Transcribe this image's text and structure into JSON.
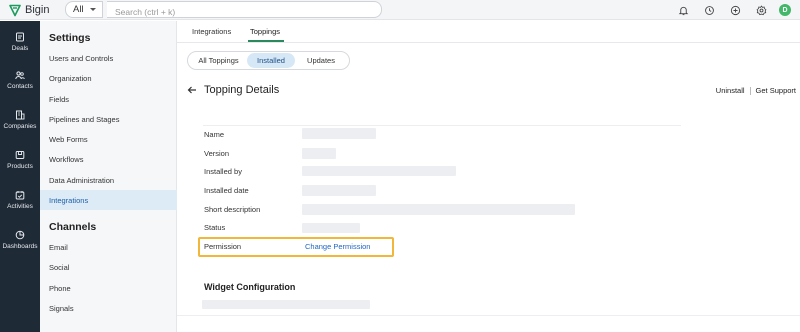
{
  "brand": {
    "name": "Bigin"
  },
  "search": {
    "module": "All",
    "placeholder": "Search (ctrl + k)"
  },
  "topbar_icons": [
    "bell-icon",
    "sync-icon",
    "plus-circle-icon",
    "gear-icon"
  ],
  "user": {
    "initial": "D",
    "color": "#43b86a"
  },
  "rail": {
    "items": [
      {
        "label": "Deals",
        "icon": "deals-icon"
      },
      {
        "label": "Contacts",
        "icon": "contacts-icon"
      },
      {
        "label": "Companies",
        "icon": "companies-icon"
      },
      {
        "label": "Products",
        "icon": "products-icon"
      },
      {
        "label": "Activities",
        "icon": "activities-icon"
      },
      {
        "label": "Dashboards",
        "icon": "dashboards-icon"
      }
    ]
  },
  "settings": {
    "title": "Settings",
    "items": [
      "Users and Controls",
      "Organization",
      "Fields",
      "Pipelines and Stages",
      "Web Forms",
      "Workflows",
      "Data Administration",
      "Integrations"
    ],
    "active": "Integrations",
    "channels_title": "Channels",
    "channels": [
      "Email",
      "Social",
      "Phone",
      "Signals"
    ]
  },
  "tabs": {
    "integrations": "Integrations",
    "toppings": "Toppings",
    "active": "Toppings"
  },
  "segments": {
    "all": "All Toppings",
    "installed": "Installed",
    "updates": "Updates",
    "active": "Installed"
  },
  "details": {
    "title": "Topping Details",
    "uninstall": "Uninstall",
    "support": "Get Support",
    "fields": {
      "name": "Name",
      "version": "Version",
      "installed_by": "Installed by",
      "installed_date": "Installed date",
      "short_description": "Short description",
      "status": "Status",
      "permission": "Permission"
    },
    "change_permission": "Change Permission",
    "widget_config": "Widget Configuration"
  },
  "colors": {
    "accent": "#2a8a5e",
    "link": "#1f66c2",
    "highlight": "#f0b73a",
    "rail": "#1f2a37"
  }
}
